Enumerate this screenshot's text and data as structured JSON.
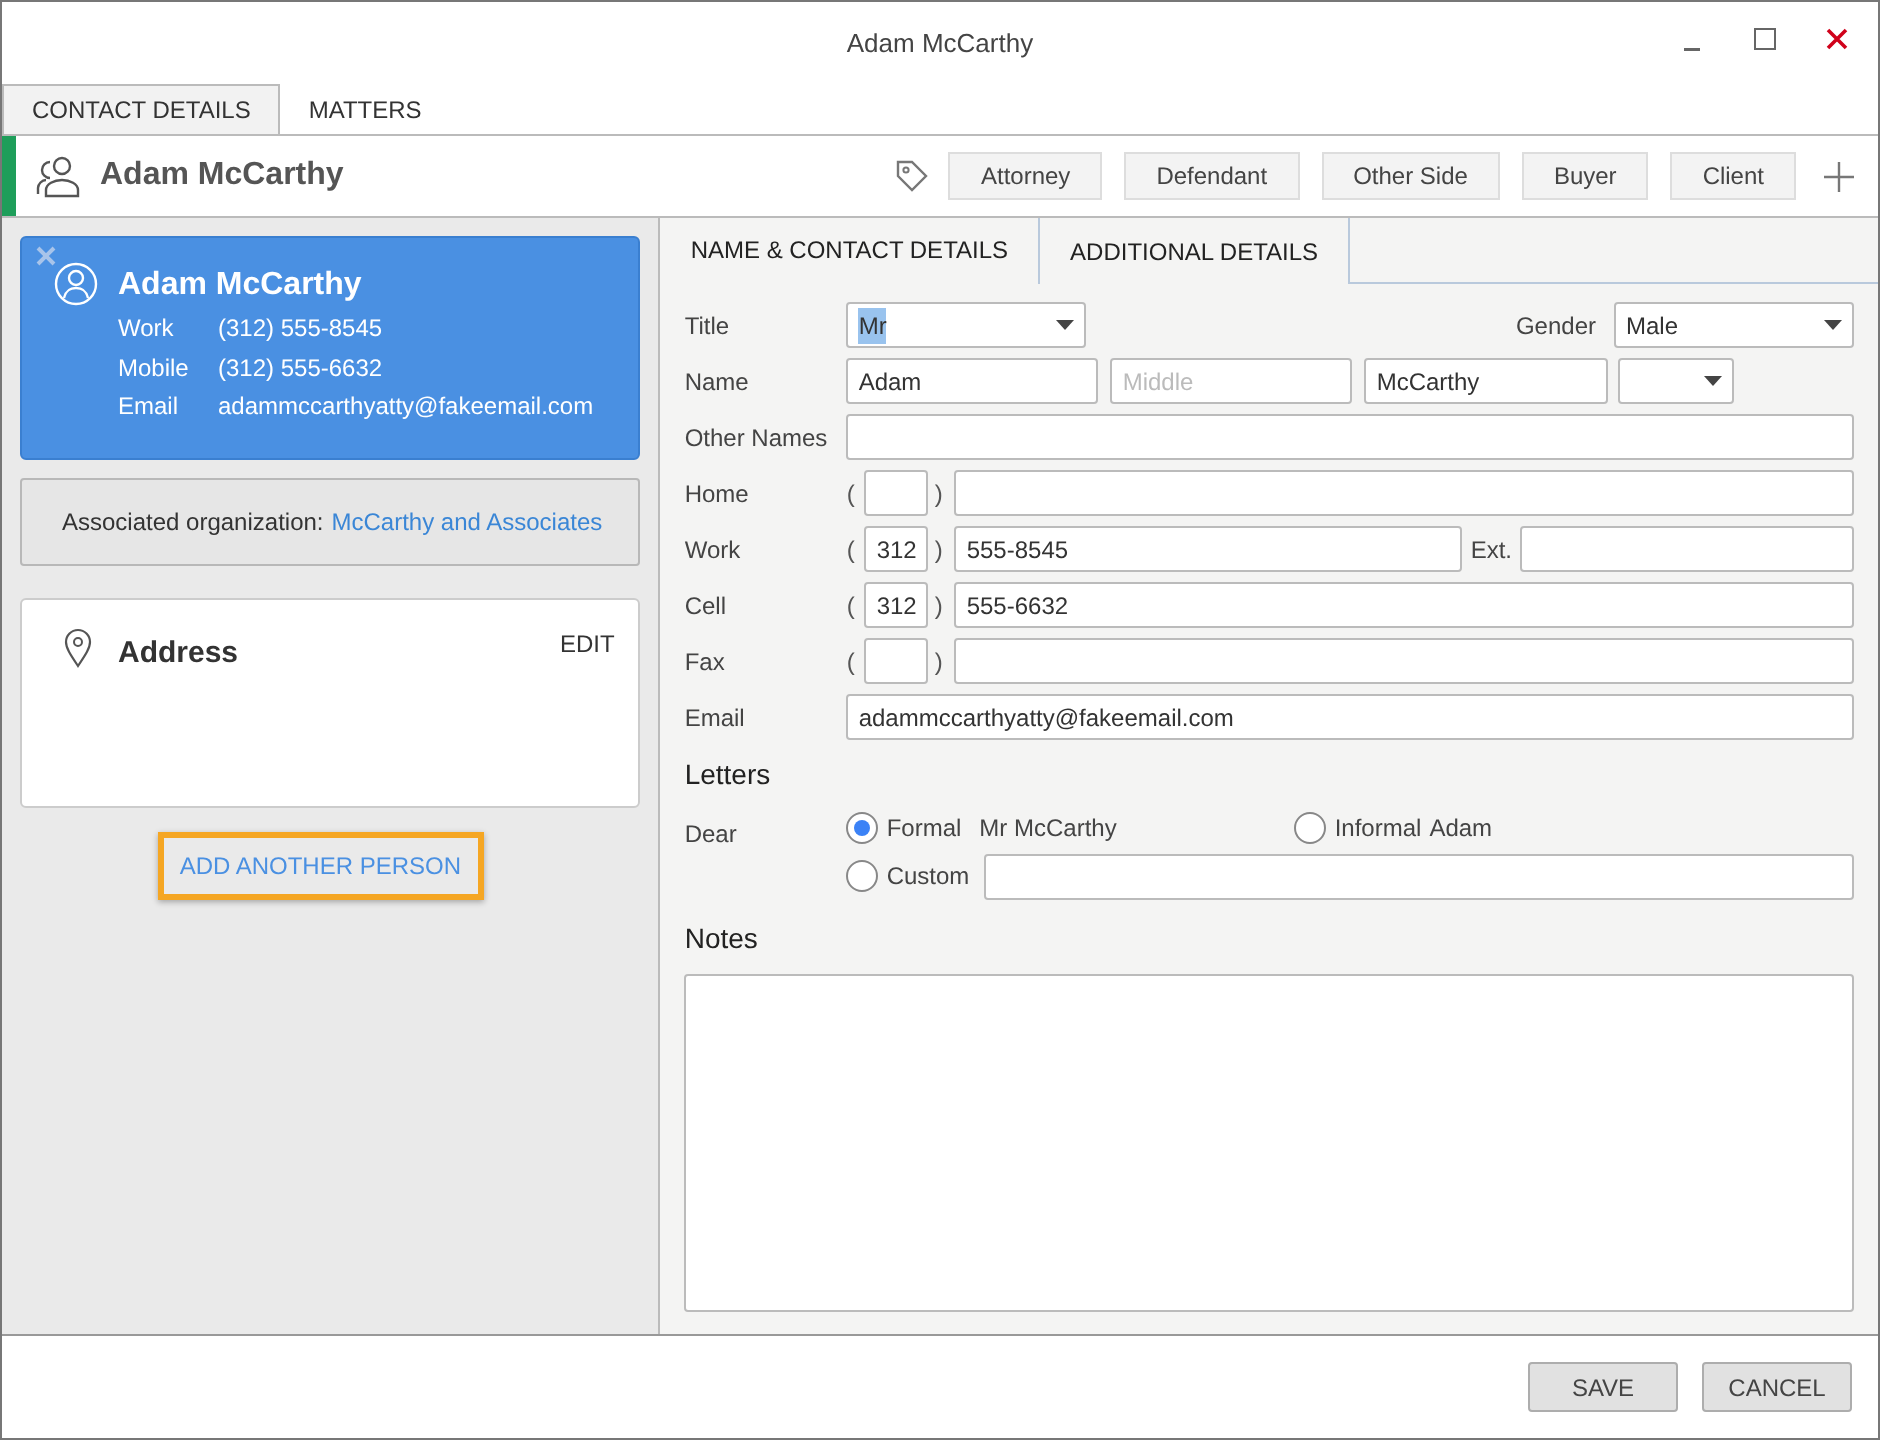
{
  "window": {
    "title": "Adam McCarthy"
  },
  "top_tabs": [
    {
      "label": "CONTACT DETAILS",
      "selected": true
    },
    {
      "label": "MATTERS",
      "selected": false
    }
  ],
  "header": {
    "name": "Adam McCarthy",
    "roles": [
      "Attorney",
      "Defendant",
      "Other Side",
      "Buyer",
      "Client"
    ]
  },
  "person_card": {
    "name": "Adam McCarthy",
    "details": [
      {
        "label": "Work",
        "value": "(312) 555-8545"
      },
      {
        "label": "Mobile",
        "value": "(312) 555-6632"
      },
      {
        "label": "Email",
        "value": "adammccarthyatty@fakeemail.com"
      }
    ]
  },
  "organization": {
    "label": "Associated organization:",
    "link": "McCarthy and Associates"
  },
  "address": {
    "title": "Address",
    "edit": "EDIT"
  },
  "add_person": "ADD ANOTHER PERSON",
  "form_tabs": [
    {
      "label": "NAME & CONTACT DETAILS",
      "selected": true
    },
    {
      "label": "ADDITIONAL DETAILS",
      "selected": false
    }
  ],
  "form": {
    "title": {
      "label": "Title",
      "value": "Mr",
      "text_selected": true
    },
    "gender": {
      "label": "Gender",
      "value": "Male"
    },
    "name": {
      "label": "Name",
      "first": "Adam",
      "middle_placeholder": "Middle",
      "last": "McCarthy"
    },
    "other_names": {
      "label": "Other Names"
    },
    "phones": [
      {
        "label": "Home",
        "open": "(",
        "close": ")"
      },
      {
        "label": "Work",
        "open": "(",
        "area": "312",
        "close": ")",
        "number": "555-8545",
        "ext_label": "Ext."
      },
      {
        "label": "Cell",
        "open": "(",
        "area": "312",
        "close": ")",
        "number": "555-6632"
      },
      {
        "label": "Fax",
        "open": "(",
        "close": ")"
      }
    ],
    "email": {
      "label": "Email",
      "value": "adammccarthyatty@fakeemail.com"
    },
    "letters": {
      "heading": "Letters",
      "dear": "Dear",
      "options": [
        {
          "label": "Formal",
          "preview": "Mr McCarthy",
          "selected": true
        },
        {
          "label": "Informal",
          "preview": "Adam",
          "selected": false
        },
        {
          "label": "Custom",
          "selected": false
        }
      ]
    },
    "notes": {
      "heading": "Notes"
    }
  },
  "buttons": [
    "SAVE",
    "CANCEL"
  ]
}
